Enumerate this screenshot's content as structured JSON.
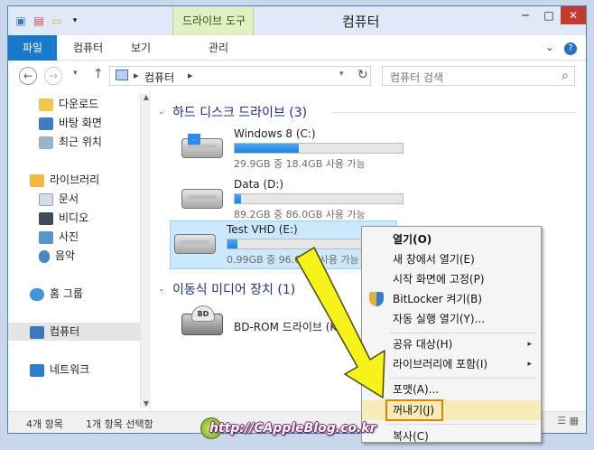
{
  "window": {
    "title": "컴퓨터",
    "contextual_tab_group": "드라이브 도구",
    "controls": {
      "minimize": "─",
      "maximize": "□",
      "close": "✕"
    }
  },
  "ribbon": {
    "tabs": [
      {
        "label": "파일"
      },
      {
        "label": "컴퓨터"
      },
      {
        "label": "보기"
      },
      {
        "label": "관리"
      }
    ],
    "expand_chevron": "⌄",
    "help": "?"
  },
  "nav": {
    "back": "←",
    "forward": "→",
    "recent": "▾",
    "up": "↑",
    "address_path": "컴퓨터",
    "address_sep": "▸",
    "address_dropdown": "▾",
    "refresh": "↻",
    "search_placeholder": "컴퓨터 검색",
    "search_icon": "⌕"
  },
  "sidebar": {
    "items": [
      {
        "label": "다운로드",
        "icon": "download-folder-icon",
        "color": "#f1c94a"
      },
      {
        "label": "바탕 화면",
        "icon": "desktop-icon",
        "color": "#3f7cc6"
      },
      {
        "label": "최근 위치",
        "icon": "recent-places-icon",
        "color": "#9fb3c8"
      },
      {
        "label": "라이브러리",
        "icon": "library-icon",
        "color": "#f0b840"
      },
      {
        "label": "문서",
        "icon": "documents-icon",
        "color": "#d9dde3"
      },
      {
        "label": "비디오",
        "icon": "videos-icon",
        "color": "#3d4a5c"
      },
      {
        "label": "사진",
        "icon": "pictures-icon",
        "color": "#5a94c8"
      },
      {
        "label": "음악",
        "icon": "music-icon",
        "color": "#4b86c6"
      },
      {
        "label": "홈 그룹",
        "icon": "homegroup-icon",
        "color": "#3f96d8"
      },
      {
        "label": "컴퓨터",
        "icon": "computer-icon",
        "color": "#3b78c2"
      },
      {
        "label": "네트워크",
        "icon": "network-icon",
        "color": "#2b7fcd"
      }
    ]
  },
  "content": {
    "groups": [
      {
        "title": "하드 디스크 드라이브 (3)"
      },
      {
        "title": "이동식 미디어 장치 (1)"
      }
    ],
    "drives": [
      {
        "name": "Windows 8 (C:)",
        "free_text": "29.9GB 중 18.4GB 사용 가능",
        "used_fraction": 0.38
      },
      {
        "name": "Data (D:)",
        "free_text": "89.2GB 중 86.0GB 사용 가능",
        "used_fraction": 0.04
      },
      {
        "name": "Test VHD (E:)",
        "free_text": "0.99GB 중 96.0MB 사용 가능",
        "used_fraction": 0.06
      }
    ],
    "removable": [
      {
        "name": "BD-ROM 드라이브 (K:)",
        "disc_label": "BD"
      }
    ]
  },
  "status": {
    "items_count": "4개 항목",
    "selected": "1개 항목 선택함"
  },
  "context_menu": {
    "items": [
      {
        "label": "열기(O)",
        "bold": true
      },
      {
        "label": "새 창에서 열기(E)"
      },
      {
        "label": "시작 화면에 고정(P)"
      },
      {
        "label": "BitLocker 켜기(B)",
        "icon": "shield-icon"
      },
      {
        "label": "자동 실행 열기(Y)..."
      },
      {
        "label": "공유 대상(H)",
        "submenu": "▸"
      },
      {
        "label": "라이브러리에 포함(I)",
        "submenu": "▸"
      },
      {
        "label": "포맷(A)..."
      },
      {
        "label": "꺼내기(J)",
        "highlighted": true
      },
      {
        "label": "복사(C)"
      }
    ]
  },
  "watermark": "http://CAppleBlog.co.kr",
  "colors": {
    "accent": "#1979ca",
    "arrow": "#f6f21a",
    "highlight_border": "#d48a00"
  }
}
